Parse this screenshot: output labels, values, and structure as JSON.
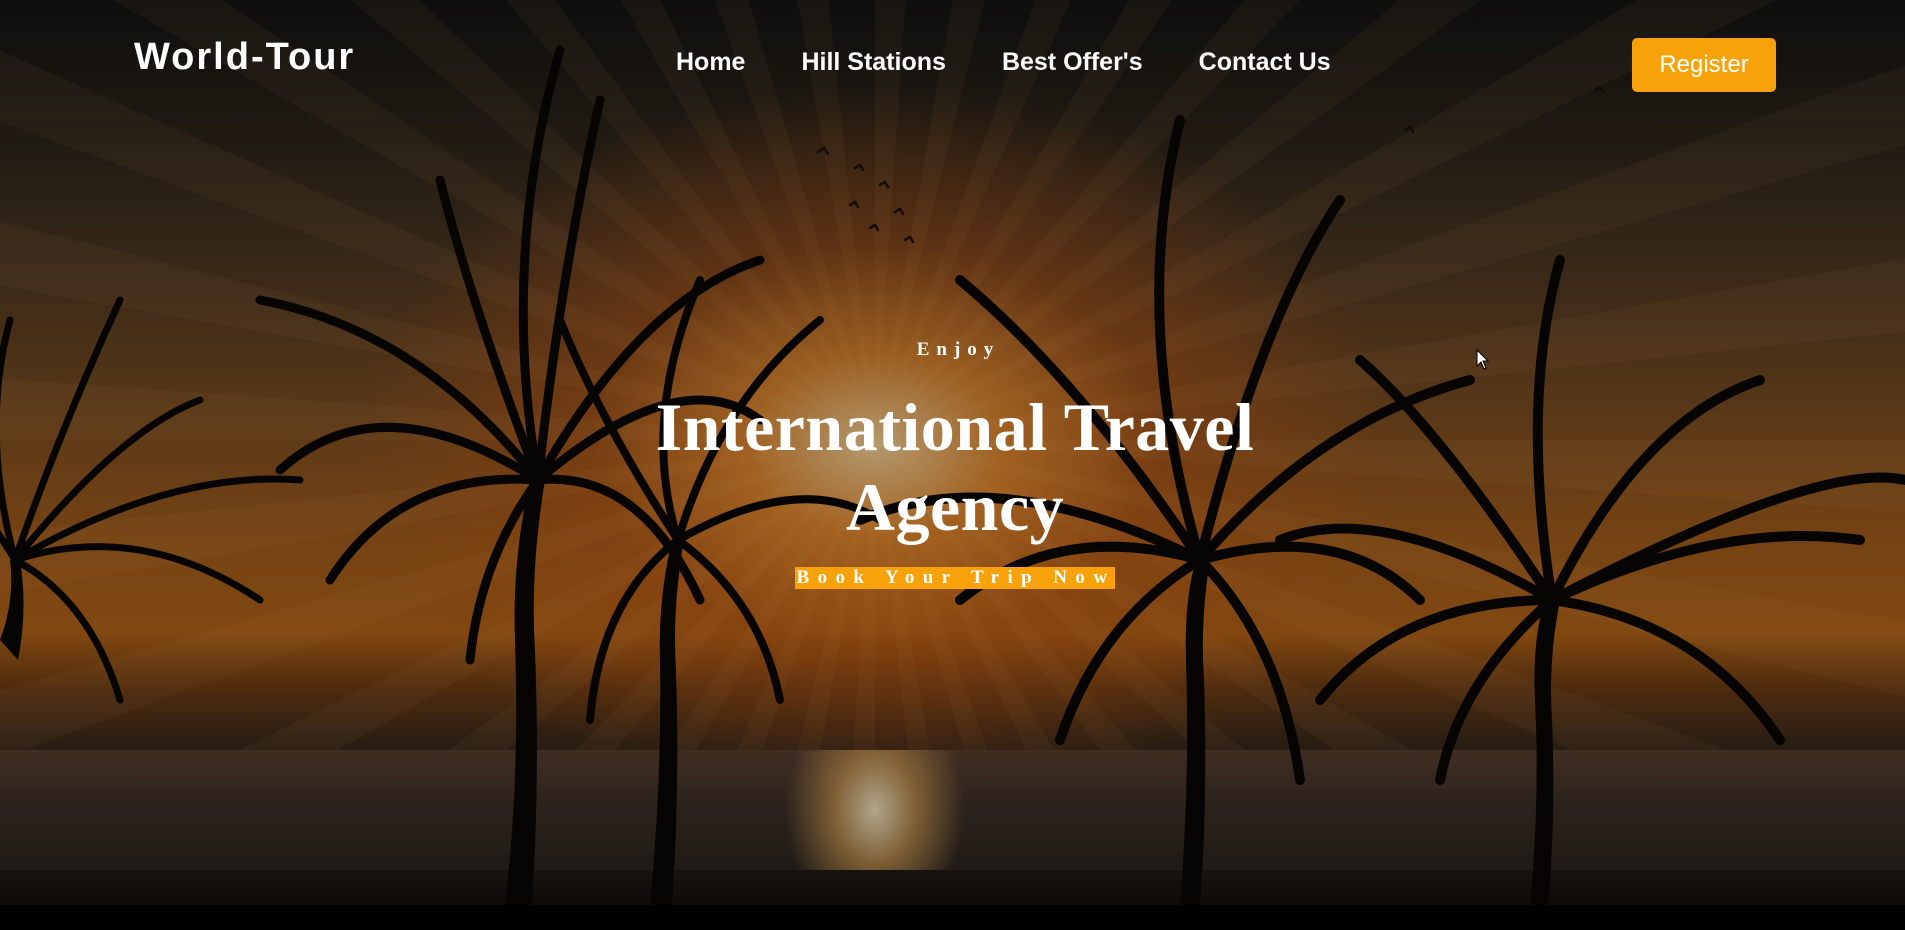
{
  "navbar": {
    "logo": "World-Tour",
    "links": [
      {
        "label": "Home"
      },
      {
        "label": "Hill Stations"
      },
      {
        "label": "Best Offer's"
      },
      {
        "label": "Contact Us"
      }
    ],
    "register_label": "Register"
  },
  "hero": {
    "kicker": "Enjoy",
    "title": "International Travel Agency",
    "cta_label": "Book Your Trip Now"
  },
  "colors": {
    "accent": "#f7a20a",
    "text": "#ffffff"
  },
  "icons": {
    "cursor": "mouse-pointer-icon"
  }
}
